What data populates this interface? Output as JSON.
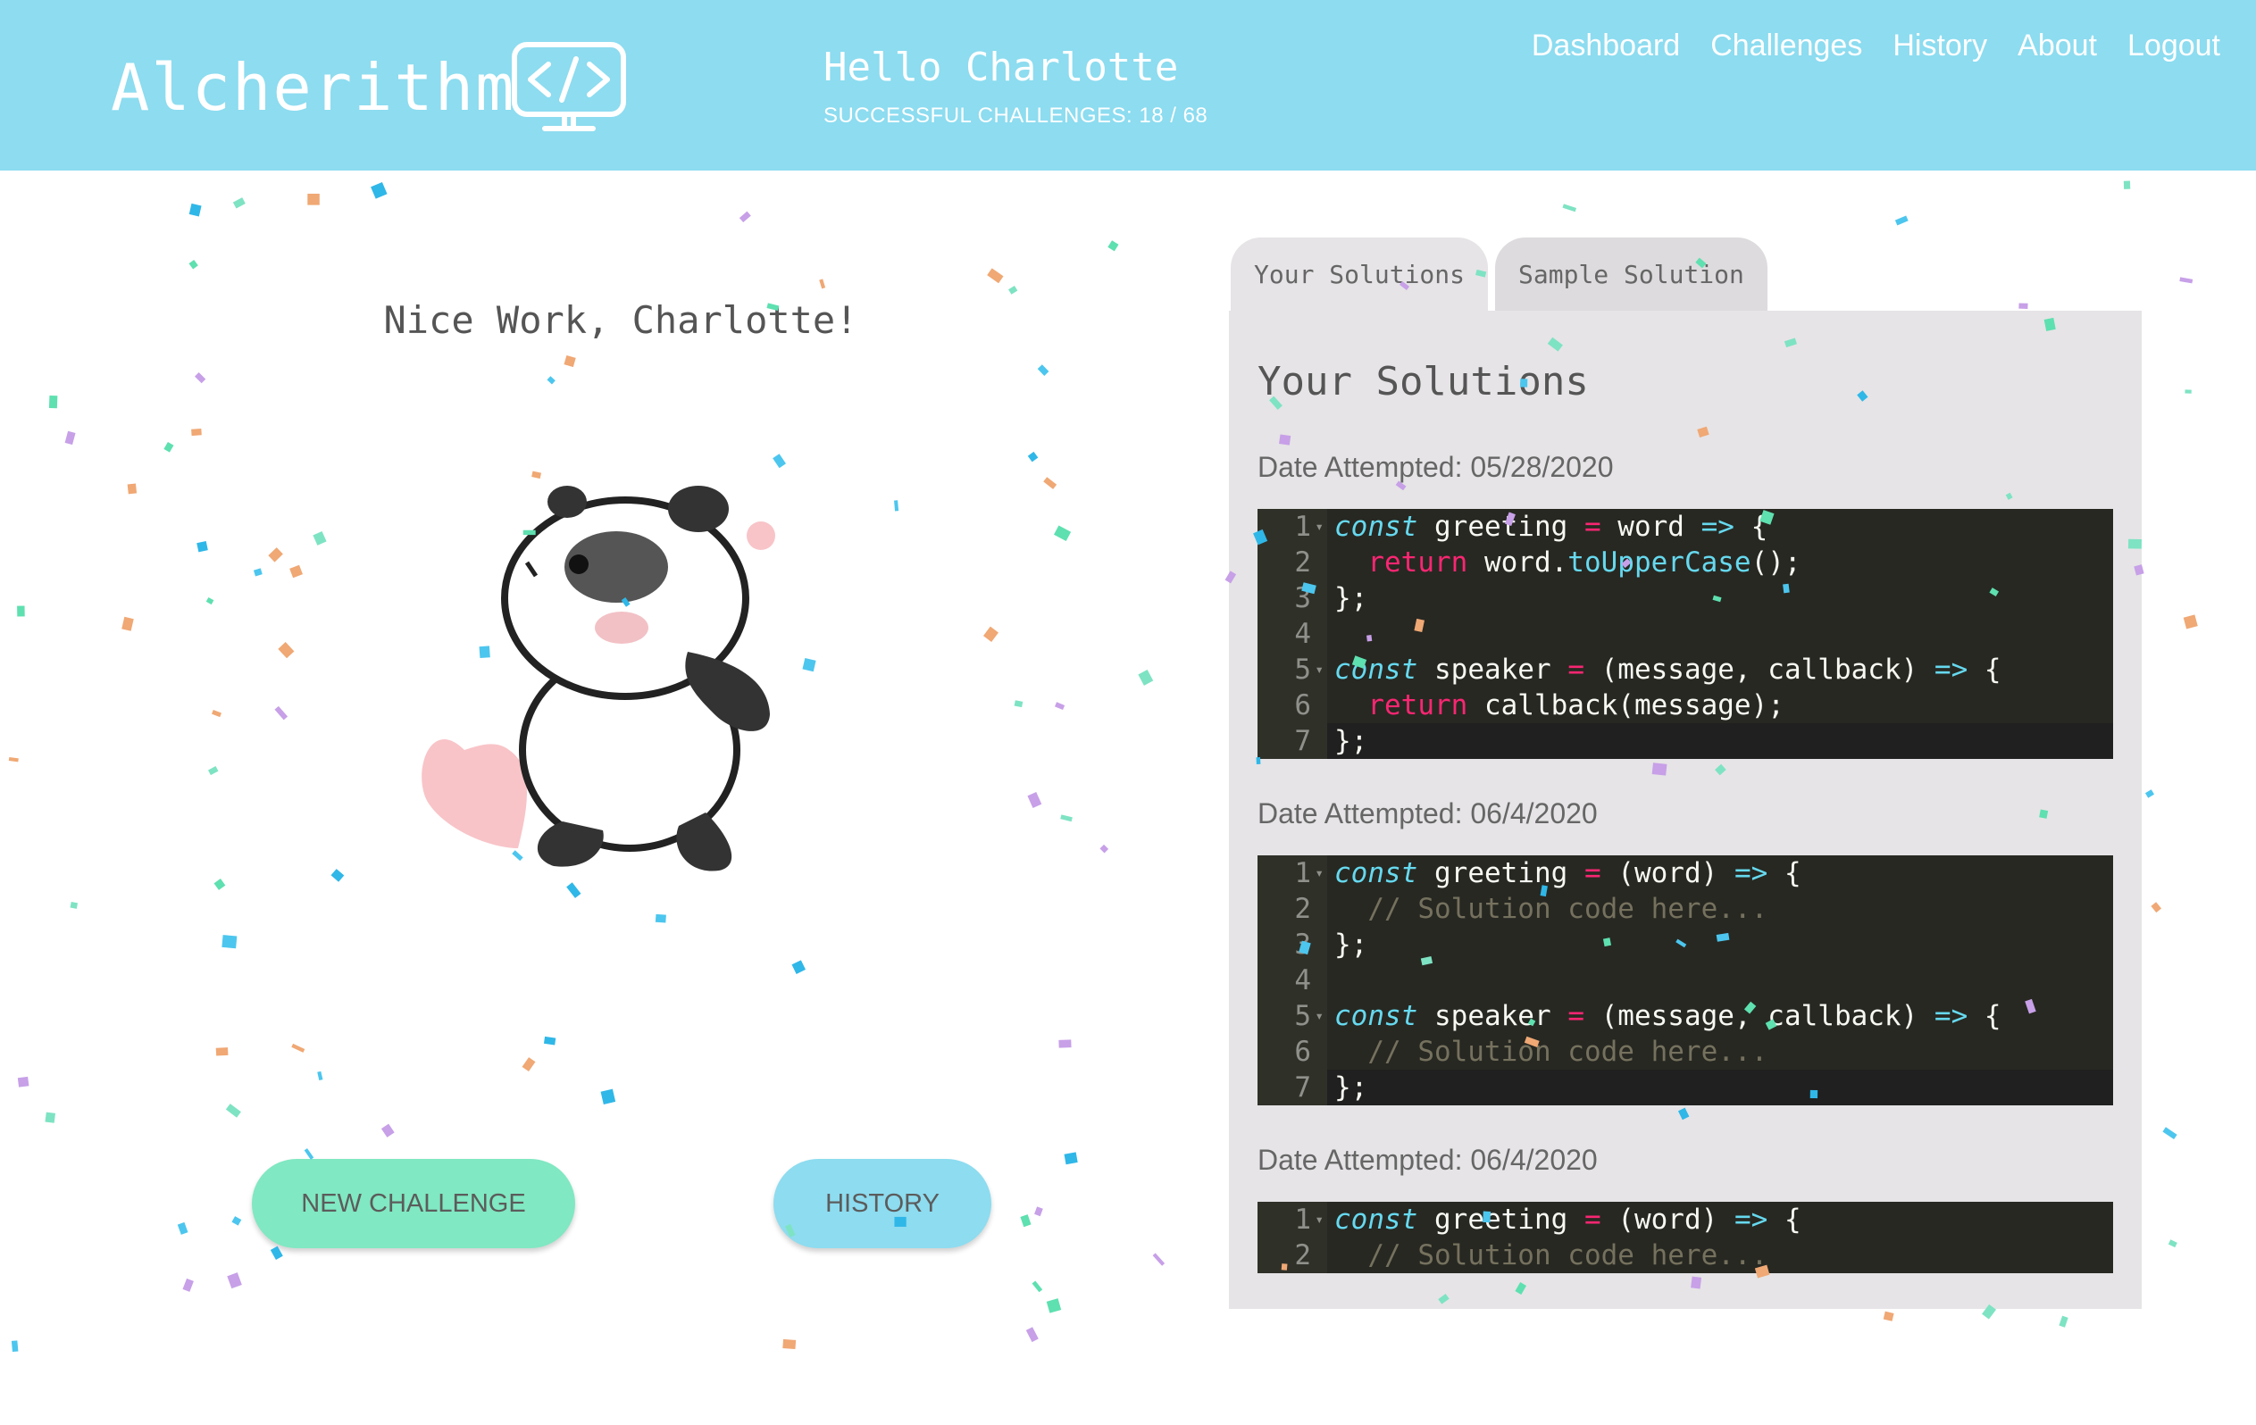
{
  "header": {
    "logo_text": "Alcherithm",
    "greeting": "Hello Charlotte",
    "progress": "SUCCESSFUL CHALLENGES: 18 / 68",
    "nav": [
      "Dashboard",
      "Challenges",
      "History",
      "About",
      "Logout"
    ]
  },
  "main": {
    "congrats": "Nice Work, Charlotte!",
    "new_challenge_label": "NEW CHALLENGE",
    "history_label": "HISTORY"
  },
  "solutions": {
    "tabs": [
      "Your Solutions",
      "Sample Solution"
    ],
    "active_tab": "Your Solutions",
    "title": "Your Solutions",
    "attempts": [
      {
        "date": "Date Attempted: 05/28/2020",
        "lines": [
          "const greeting = word => {",
          "  return word.toUpperCase();",
          "};",
          "",
          "const speaker = (message, callback) => {",
          "  return callback(message);",
          "};"
        ]
      },
      {
        "date": "Date Attempted: 06/4/2020",
        "lines": [
          "const greeting = (word) => {",
          "  // Solution code here...",
          "};",
          "",
          "const speaker = (message, callback) => {",
          "  // Solution code here...",
          "};"
        ]
      },
      {
        "date": "Date Attempted: 06/4/2020",
        "lines": [
          "const greeting = (word) => {",
          "  // Solution code here..."
        ]
      }
    ]
  },
  "colors": {
    "header_bg": "#8ddcf0",
    "new_challenge_bg": "#80e8c2",
    "history_bg": "#8ddcf0",
    "editor_bg": "#272822",
    "panel_bg": "#e6e4e6"
  },
  "icons": [
    "code-monitor-icon",
    "panda-illustration",
    "confetti"
  ]
}
